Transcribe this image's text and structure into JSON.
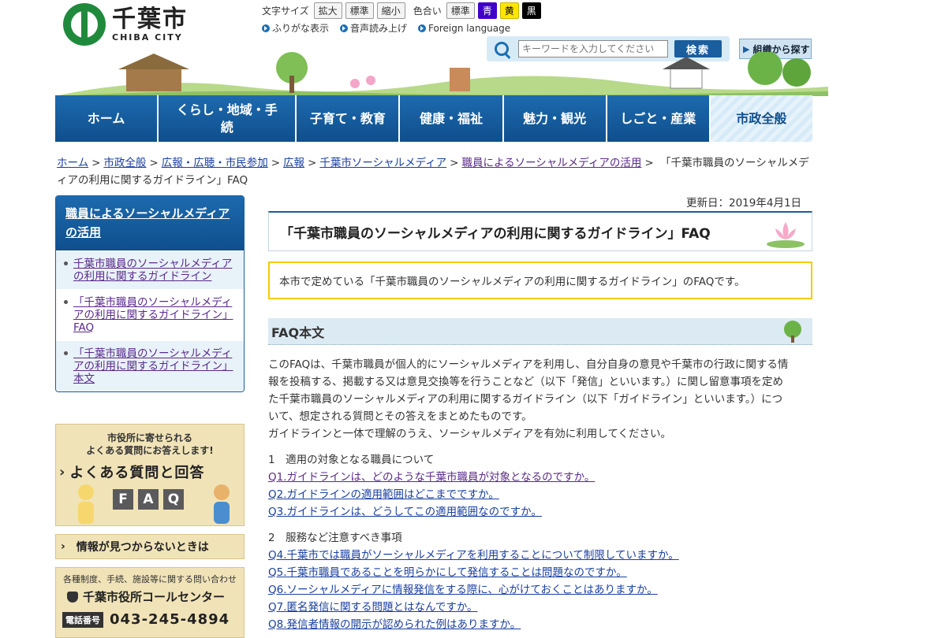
{
  "header": {
    "logo_jp": "千葉市",
    "logo_en": "CHIBA CITY",
    "font_size_label": "文字サイズ",
    "font_buttons": [
      "拡大",
      "標準",
      "縮小"
    ],
    "color_label": "色合い",
    "color_buttons": [
      "標準",
      "青",
      "黄",
      "黒"
    ],
    "links": [
      "ふりがな表示",
      "音声読み上げ",
      "Foreign language"
    ],
    "search_placeholder": "キーワードを入力してください",
    "search_button": "検索",
    "org_button": "組織から探す"
  },
  "gnav": [
    {
      "label": "ホーム"
    },
    {
      "label": "くらし・地域・手続"
    },
    {
      "label": "子育て・教育"
    },
    {
      "label": "健康・福祉"
    },
    {
      "label": "魅力・観光"
    },
    {
      "label": "しごと・産業"
    },
    {
      "label": "市政全般"
    }
  ],
  "breadcrumb": {
    "items": [
      "ホーム",
      "市政全般",
      "広報・広聴・市民参加",
      "広報",
      "千葉市ソーシャルメディア",
      "職員によるソーシャルメディアの活用"
    ],
    "current": "千葉市職員のソーシャルメディアの利用に関するガイドライン」FAQ",
    "current_prefix": "「"
  },
  "sidebar": {
    "heading": "職員によるソーシャルメディアの活用",
    "items": [
      "千葉市職員のソーシャルメディアの利用に関するガイドライン",
      "「千葉市職員のソーシャルメディアの利用に関するガイドライン」FAQ",
      "「千葉市職員のソーシャルメディアの利用に関するガイドライン」本文"
    ],
    "faq_banner": {
      "line1": "市役所に寄せられる",
      "line2": "よくある質問にお答えします!",
      "title": "よくある質問と回答",
      "letters": [
        "F",
        "A",
        "Q"
      ]
    },
    "not_found": "情報が見つからないときは",
    "call_center": {
      "top": "各種制度、手続、施設等に関する問い合わせ",
      "name": "千葉市役所コールセンター",
      "tel_label": "電話番号",
      "tel": "043-245-4894"
    }
  },
  "main": {
    "updated": "更新日：2019年4月1日",
    "title": "「千葉市職員のソーシャルメディアの利用に関するガイドライン」FAQ",
    "intro": "本市で定めている「千葉市職員のソーシャルメディアの利用に関するガイドライン」のFAQです。",
    "faq_heading": "FAQ本文",
    "body_lines": [
      "このFAQは、千葉市職員が個人的にソーシャルメディアを利用し、自分自身の意見や千葉市の行政に関する情",
      "報を投稿する、掲載する又は意見交換等を行うことなど（以下「発信」といいます。）に関し留意事項を定め",
      "た千葉市職員のソーシャルメディアの利用に関するガイドライン（以下「ガイドライン」といいます。）につ",
      "いて、想定される質問とその答えをまとめたものです。",
      "ガイドラインと一体で理解のうえ、ソーシャルメディアを有効に利用してください。"
    ],
    "section1": "1　適用の対象となる職員について",
    "section1_questions": [
      "Q1.ガイドラインは、どのような千葉市職員が対象となるのですか。",
      "Q2.ガイドラインの適用範囲はどこまでですか。",
      "Q3.ガイドラインは、どうしてこの適用範囲なのですか。"
    ],
    "section2": "2　服務など注意すべき事項",
    "section2_questions": [
      "Q4.千葉市では職員がソーシャルメディアを利用することについて制限していますか。",
      "Q5.千葉市職員であることを明らかにして発信することは問題なのですか。",
      "Q6.ソーシャルメディアに情報発信をする際に、心がけておくことはありますか。",
      "Q7.匿名発信に関する問題とはなんですか。",
      "Q8.発信者情報の開示が認められた例はありますか。"
    ]
  },
  "colors": {
    "nav_blue": "#1d6aae",
    "link_blue": "#1a3fa0",
    "visited_purple": "#5a2a8a",
    "intro_border": "#f2cd00",
    "banner_beige": "#f1e3b8"
  }
}
